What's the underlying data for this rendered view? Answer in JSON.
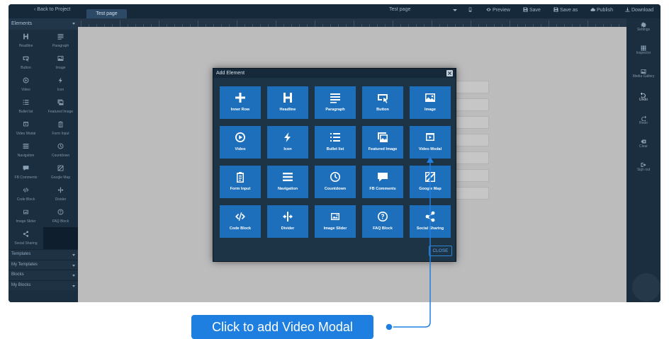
{
  "topbar": {
    "back_label": "Back to Project",
    "page_tab": "Test page",
    "page_select": "Test page",
    "buttons": [
      "Preview",
      "Save",
      "Save as",
      "Publish",
      "Download"
    ]
  },
  "left_sidebar": {
    "header": "Elements",
    "tools": [
      {
        "label": "Headline",
        "icon": "headline-icon"
      },
      {
        "label": "Paragraph",
        "icon": "paragraph-icon"
      },
      {
        "label": "Button",
        "icon": "button-icon"
      },
      {
        "label": "Image",
        "icon": "image-icon"
      },
      {
        "label": "Video",
        "icon": "video-icon"
      },
      {
        "label": "Icon",
        "icon": "bolt-icon"
      },
      {
        "label": "Bullet list",
        "icon": "bullet-list-icon"
      },
      {
        "label": "Featured Image",
        "icon": "featured-image-icon"
      },
      {
        "label": "Video Modal",
        "icon": "video-modal-icon"
      },
      {
        "label": "Form Input",
        "icon": "form-input-icon"
      },
      {
        "label": "Navigation",
        "icon": "navigation-icon"
      },
      {
        "label": "Countdown",
        "icon": "countdown-icon"
      },
      {
        "label": "FB Comments",
        "icon": "comments-icon"
      },
      {
        "label": "Google Map",
        "icon": "map-icon"
      },
      {
        "label": "Code Block",
        "icon": "code-icon"
      },
      {
        "label": "Divider",
        "icon": "divider-icon"
      },
      {
        "label": "Image Slider",
        "icon": "slider-icon"
      },
      {
        "label": "FAQ Block",
        "icon": "faq-icon"
      },
      {
        "label": "Social Sharing",
        "icon": "share-icon"
      }
    ],
    "sections": [
      "Templates",
      "My Templates",
      "Blocks",
      "My Blocks"
    ]
  },
  "right_sidebar": {
    "items": [
      {
        "label": "Settings",
        "icon": "gear-icon"
      },
      {
        "label": "Inspector",
        "icon": "inspector-icon"
      },
      {
        "label": "Media Gallery",
        "icon": "media-gallery-icon"
      },
      {
        "label": "Undo",
        "icon": "undo-icon"
      },
      {
        "label": "Redo",
        "icon": "redo-icon"
      },
      {
        "label": "Clear",
        "icon": "clear-icon"
      },
      {
        "label": "Sign out",
        "icon": "sign-out-icon"
      }
    ]
  },
  "modal": {
    "title": "Add Element",
    "tiles": [
      {
        "label": "Inner Row",
        "icon": "plus-icon"
      },
      {
        "label": "Headline",
        "icon": "headline-icon"
      },
      {
        "label": "Paragraph",
        "icon": "paragraph-icon"
      },
      {
        "label": "Button",
        "icon": "button-icon"
      },
      {
        "label": "Image",
        "icon": "image-icon"
      },
      {
        "label": "Video",
        "icon": "video-icon"
      },
      {
        "label": "Icon",
        "icon": "bolt-icon"
      },
      {
        "label": "Bullet list",
        "icon": "bullet-list-icon"
      },
      {
        "label": "Featured Image",
        "icon": "featured-image-icon"
      },
      {
        "label": "Video Modal",
        "icon": "video-modal-icon"
      },
      {
        "label": "Form Input",
        "icon": "form-input-icon"
      },
      {
        "label": "Navigation",
        "icon": "navigation-icon"
      },
      {
        "label": "Countdown",
        "icon": "countdown-icon"
      },
      {
        "label": "FB Comments",
        "icon": "comments-icon"
      },
      {
        "label": "Google Map",
        "icon": "map-icon"
      },
      {
        "label": "Code Block",
        "icon": "code-icon"
      },
      {
        "label": "Divider",
        "icon": "divider-icon"
      },
      {
        "label": "Image Slider",
        "icon": "slider-icon"
      },
      {
        "label": "FAQ Block",
        "icon": "faq-icon"
      },
      {
        "label": "Social Sharing",
        "icon": "share-icon"
      }
    ],
    "close_label": "CLOSE"
  },
  "annotation": {
    "text": "Click to add Video Modal",
    "color": "#1f7fe0"
  },
  "colors": {
    "tile": "#1e6fbb",
    "accent": "#1f7fe0"
  }
}
